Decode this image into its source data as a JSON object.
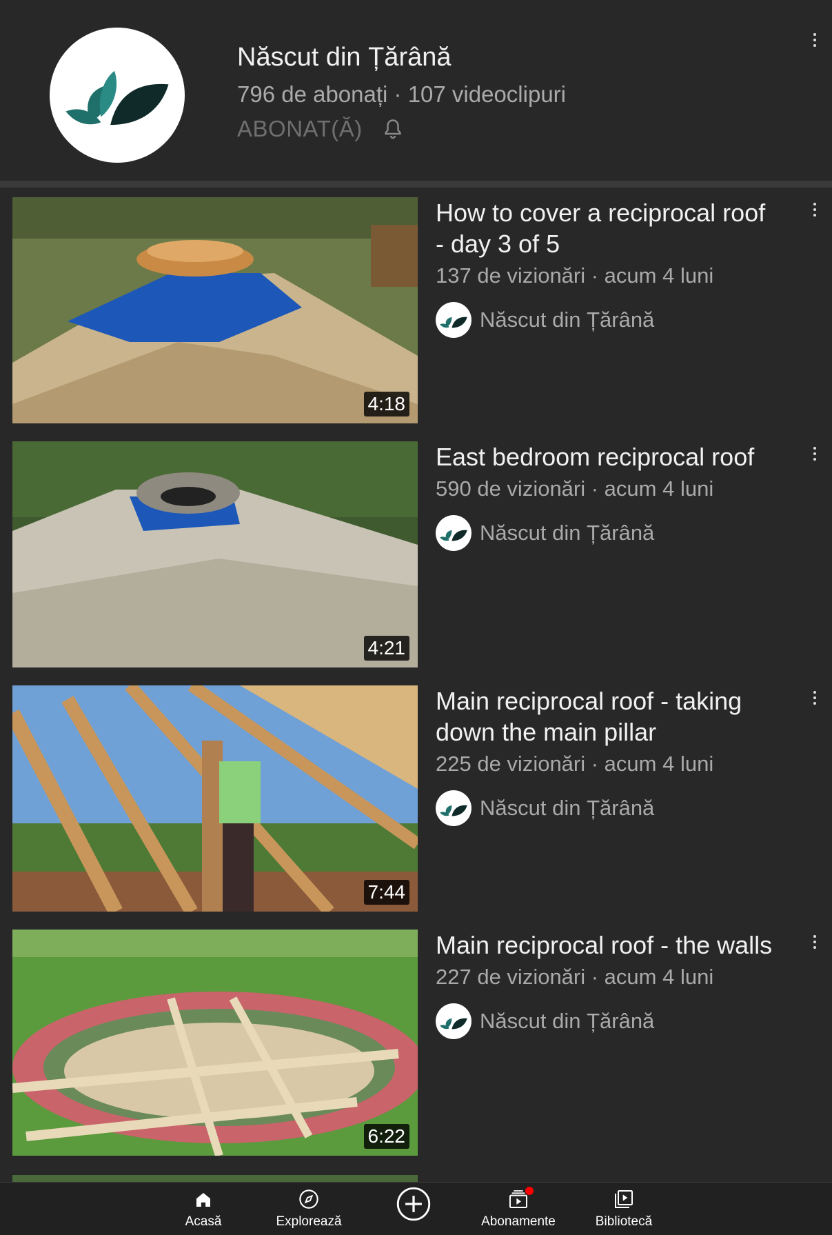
{
  "channel": {
    "name": "Născut din Țărână",
    "meta": "796 de abonați · 107 videoclipuri",
    "subscribed_label": "ABONAT(Ă)"
  },
  "videos": [
    {
      "title": "How to cover a reciprocal roof - day 3 of 5",
      "meta": "137 de vizionări · acum 4 luni",
      "channel": "Născut din Țărână",
      "duration": "4:18"
    },
    {
      "title": "East bedroom reciprocal roof",
      "meta": "590 de vizionări · acum 4 luni",
      "channel": "Născut din Țărână",
      "duration": "4:21"
    },
    {
      "title": "Main reciprocal roof - taking down the main pillar",
      "meta": "225 de vizionări · acum 4 luni",
      "channel": "Născut din Țărână",
      "duration": "7:44"
    },
    {
      "title": "Main reciprocal roof - the walls",
      "meta": "227 de vizionări · acum 4 luni",
      "channel": "Născut din Țărână",
      "duration": "6:22"
    }
  ],
  "nav": {
    "home": "Acasă",
    "explore": "Explorează",
    "subscriptions": "Abonamente",
    "library": "Bibliotecă"
  },
  "colors": {
    "background": "#282828",
    "secondary_text": "#aaaaaa",
    "notification_dot": "#ff0000",
    "logo_teal": "#1f6f6a",
    "logo_dark": "#0f2a28"
  }
}
